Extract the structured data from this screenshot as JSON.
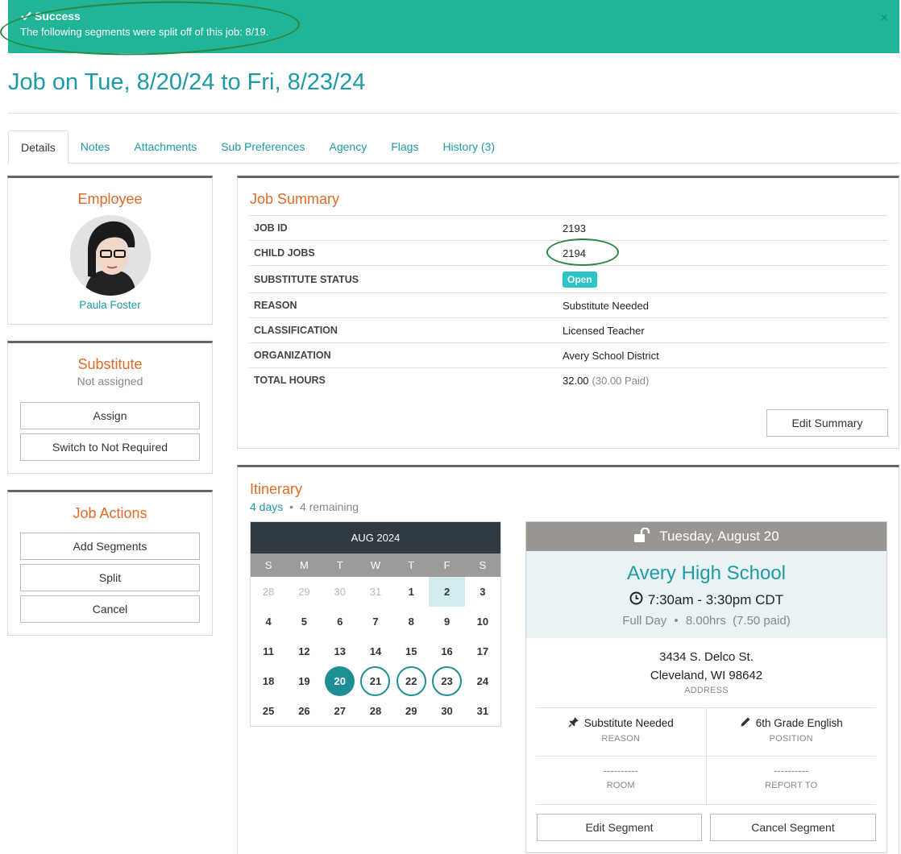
{
  "alert": {
    "title": "Success",
    "message": "The following segments were split off of this job: 8/19.",
    "close": "×",
    "color": "#1fb596"
  },
  "page": {
    "title": "Job on Tue, 8/20/24 to Fri, 8/23/24"
  },
  "tabs": [
    {
      "label": "Details",
      "active": true
    },
    {
      "label": "Notes"
    },
    {
      "label": "Attachments"
    },
    {
      "label": "Sub Preferences"
    },
    {
      "label": "Agency"
    },
    {
      "label": "Flags"
    },
    {
      "label": "History (3)"
    }
  ],
  "employee": {
    "heading": "Employee",
    "name": "Paula Foster"
  },
  "substitute": {
    "heading": "Substitute",
    "status": "Not assigned",
    "assign": "Assign",
    "not_required": "Switch to Not Required"
  },
  "job_actions": {
    "heading": "Job Actions",
    "add_segments": "Add Segments",
    "split": "Split",
    "cancel": "Cancel"
  },
  "summary": {
    "heading": "Job Summary",
    "job_id_label": "JOB ID",
    "job_id": "2193",
    "child_jobs_label": "CHILD JOBS",
    "child_jobs": "2194",
    "sub_status_label": "SUBSTITUTE STATUS",
    "sub_status": "Open",
    "reason_label": "REASON",
    "reason": "Substitute Needed",
    "classification_label": "CLASSIFICATION",
    "classification": "Licensed Teacher",
    "organization_label": "ORGANIZATION",
    "organization": "Avery School District",
    "total_hours_label": "TOTAL HOURS",
    "total_hours": "32.00",
    "total_paid": "(30.00 Paid)",
    "edit": "Edit Summary"
  },
  "itinerary": {
    "heading": "Itinerary",
    "days": "4 days",
    "bullet": "•",
    "remaining": "4 remaining"
  },
  "calendar": {
    "month": "AUG 2024",
    "dow": [
      "S",
      "M",
      "T",
      "W",
      "T",
      "F",
      "S"
    ],
    "days": [
      {
        "d": "28",
        "s": "muted"
      },
      {
        "d": "29",
        "s": "muted"
      },
      {
        "d": "30",
        "s": "muted"
      },
      {
        "d": "31",
        "s": "muted"
      },
      {
        "d": "1"
      },
      {
        "d": "2",
        "s": "today"
      },
      {
        "d": "3"
      },
      {
        "d": "4"
      },
      {
        "d": "5"
      },
      {
        "d": "6"
      },
      {
        "d": "7"
      },
      {
        "d": "8"
      },
      {
        "d": "9"
      },
      {
        "d": "10"
      },
      {
        "d": "11"
      },
      {
        "d": "12"
      },
      {
        "d": "13"
      },
      {
        "d": "14"
      },
      {
        "d": "15"
      },
      {
        "d": "16"
      },
      {
        "d": "17"
      },
      {
        "d": "18"
      },
      {
        "d": "19"
      },
      {
        "d": "20",
        "s": "fill"
      },
      {
        "d": "21",
        "s": "ring"
      },
      {
        "d": "22",
        "s": "ring"
      },
      {
        "d": "23",
        "s": "ring"
      },
      {
        "d": "24"
      },
      {
        "d": "25"
      },
      {
        "d": "26"
      },
      {
        "d": "27"
      },
      {
        "d": "28"
      },
      {
        "d": "29"
      },
      {
        "d": "30"
      },
      {
        "d": "31"
      }
    ]
  },
  "segment": {
    "date": "Tuesday, August 20",
    "school": "Avery High School",
    "time": "7:30am - 3:30pm CDT",
    "day_type": "Full Day",
    "hours": "8.00hrs",
    "paid": "(7.50 paid)",
    "address1": "3434 S. Delco St.",
    "address2": "Cleveland, WI 98642",
    "address_label": "ADDRESS",
    "reason": "Substitute Needed",
    "reason_label": "REASON",
    "position": "6th Grade English",
    "position_label": "POSITION",
    "room": "----------",
    "room_label": "ROOM",
    "report_to": "----------",
    "report_to_label": "REPORT TO",
    "edit": "Edit Segment",
    "cancel": "Cancel Segment"
  }
}
